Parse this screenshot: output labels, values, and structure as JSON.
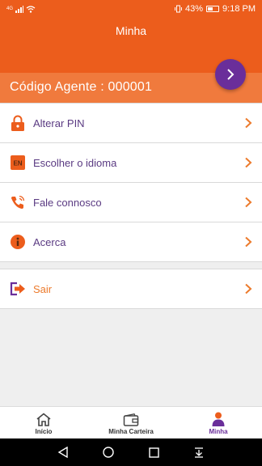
{
  "status_bar": {
    "signal": "4G",
    "battery": "43%",
    "time": "9:18 PM"
  },
  "header": {
    "title": "Minha"
  },
  "agent": {
    "label": "Código Agente : 000001"
  },
  "menu": [
    {
      "label": "Alterar PIN",
      "icon": "lock-icon"
    },
    {
      "label": "Escolher o idioma",
      "icon": "language-en-icon",
      "badge": "EN"
    },
    {
      "label": "Fale connosco",
      "icon": "phone-icon"
    },
    {
      "label": "Acerca",
      "icon": "info-icon"
    }
  ],
  "logout": {
    "label": "Sair",
    "icon": "logout-icon"
  },
  "bottom_nav": [
    {
      "label": "Início",
      "icon": "home-icon"
    },
    {
      "label": "Minha Carteira",
      "icon": "wallet-icon"
    },
    {
      "label": "Minha",
      "icon": "profile-icon",
      "active": true
    }
  ],
  "colors": {
    "primary": "#ec5d1c",
    "agent_bar": "#f07a3d",
    "accent": "#6a2e9a",
    "menu_text": "#5a3a82"
  }
}
